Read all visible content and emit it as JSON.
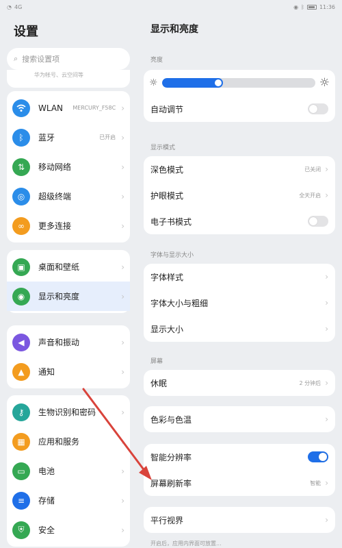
{
  "status_bar": {
    "network": "4G",
    "time": "11:36"
  },
  "left": {
    "title": "设置",
    "search_placeholder": "搜索设置项",
    "account_text": "华为帐号、云空间等",
    "groups": [
      {
        "items": [
          {
            "label": "WLAN",
            "value": "MERCURY_F58C",
            "icon": "wifi-icon",
            "color": "#2b8de9"
          },
          {
            "label": "蓝牙",
            "value": "已开启",
            "icon": "bluetooth-icon",
            "color": "#2b8de9"
          },
          {
            "label": "移动网络",
            "value": "",
            "icon": "mobile-network-icon",
            "color": "#35a853"
          },
          {
            "label": "超级终端",
            "value": "",
            "icon": "super-device-icon",
            "color": "#2b8de9"
          },
          {
            "label": "更多连接",
            "value": "",
            "icon": "link-icon",
            "color": "#f39c1f"
          }
        ]
      },
      {
        "items": [
          {
            "label": "桌面和壁纸",
            "value": "",
            "icon": "wallpaper-icon",
            "color": "#35a853"
          },
          {
            "label": "显示和亮度",
            "value": "",
            "icon": "eye-icon",
            "color": "#35a853"
          }
        ]
      },
      {
        "items": [
          {
            "label": "声音和振动",
            "value": "",
            "icon": "sound-icon",
            "color": "#7b57e0"
          },
          {
            "label": "通知",
            "value": "",
            "icon": "bell-icon",
            "color": "#f39c1f"
          }
        ]
      },
      {
        "items": [
          {
            "label": "生物识别和密码",
            "value": "",
            "icon": "key-icon",
            "color": "#26a69a"
          },
          {
            "label": "应用和服务",
            "value": "",
            "icon": "apps-icon",
            "color": "#f39c1f"
          },
          {
            "label": "电池",
            "value": "",
            "icon": "battery-icon",
            "color": "#35a853"
          },
          {
            "label": "存储",
            "value": "",
            "icon": "storage-icon",
            "color": "#1f6fe8"
          },
          {
            "label": "安全",
            "value": "",
            "icon": "shield-icon",
            "color": "#35a853"
          }
        ]
      }
    ]
  },
  "right": {
    "title": "显示和亮度",
    "brightness_label": "亮度",
    "brightness_level": 0.4,
    "auto_adjust": "自动调节",
    "display_mode_label": "显示模式",
    "dark_mode": "深色模式",
    "dark_mode_value": "已关闭",
    "eye_comfort": "护眼模式",
    "eye_comfort_value": "全天开启",
    "ebook_mode": "电子书模式",
    "font_section_label": "字体与显示大小",
    "font_style": "字体样式",
    "font_size": "字体大小与粗细",
    "display_size": "显示大小",
    "screen_label": "屏幕",
    "sleep": "休眠",
    "sleep_value": "2 分钟后",
    "color_temp": "色彩与色温",
    "smart_resolution": "智能分辨率",
    "refresh_rate": "屏幕刷新率",
    "refresh_rate_value": "智能",
    "parallel_view": "平行视界",
    "footnote": "开启后，应用内界面可放置..."
  },
  "colors": {
    "accent": "#1f6fe8",
    "arrow": "#d9433b"
  }
}
